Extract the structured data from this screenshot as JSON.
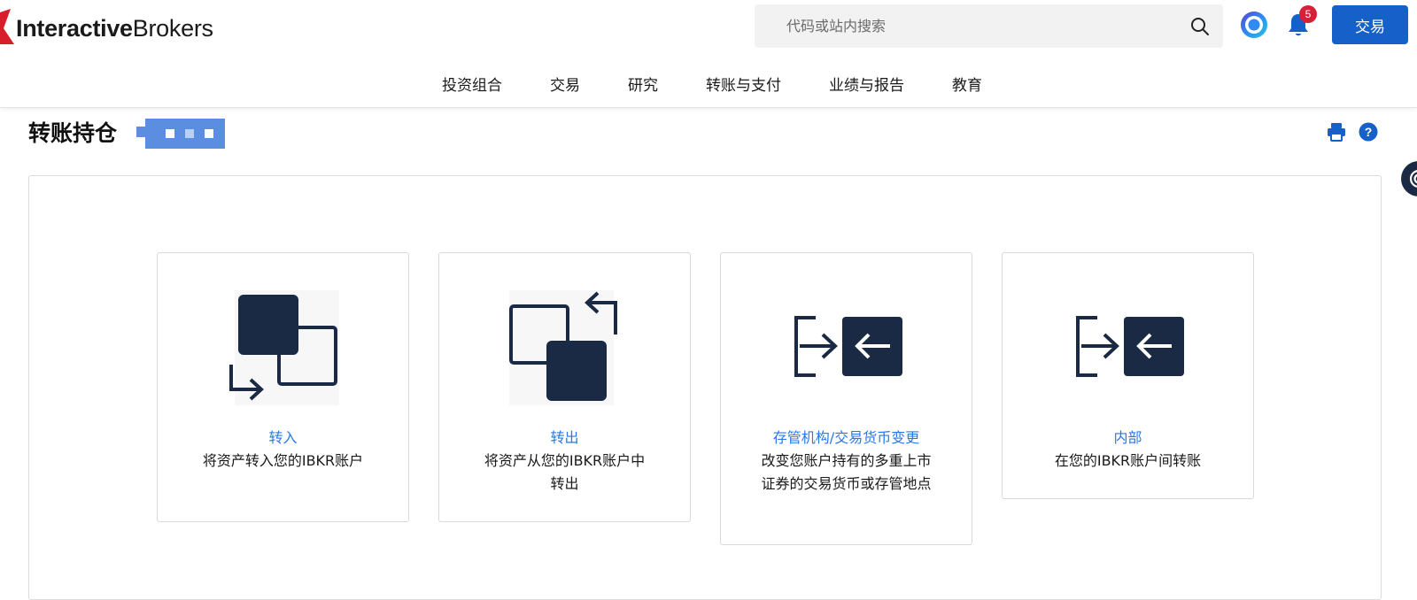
{
  "header": {
    "logo": {
      "bold": "Interactive",
      "regular": "Brokers"
    },
    "search_placeholder": "代码或站内搜索",
    "notification_count": "5",
    "trade_label": "交易"
  },
  "nav": {
    "items": [
      "投资组合",
      "交易",
      "研究",
      "转账与支付",
      "业绩与报告",
      "教育"
    ]
  },
  "page": {
    "title": "转账持仓"
  },
  "cards": [
    {
      "title": "转入",
      "desc": "将资产转入您的IBKR账户",
      "icon": "transfer-in-icon"
    },
    {
      "title": "转出",
      "desc": "将资产从您的IBKR账户中转出",
      "icon": "transfer-out-icon"
    },
    {
      "title": "存管机构/交易货币变更",
      "desc": "改变您账户持有的多重上市证券的交易货币或存管地点",
      "icon": "custodian-change-icon"
    },
    {
      "title": "内部",
      "desc": "在您的IBKR账户间转账",
      "icon": "internal-transfer-icon"
    }
  ],
  "colors": {
    "brand_blue": "#1560c9",
    "link_blue": "#2b78e4",
    "icon_navy": "#1b2a44",
    "badge_red": "#d6203a",
    "logo_red": "#d81e2a"
  }
}
